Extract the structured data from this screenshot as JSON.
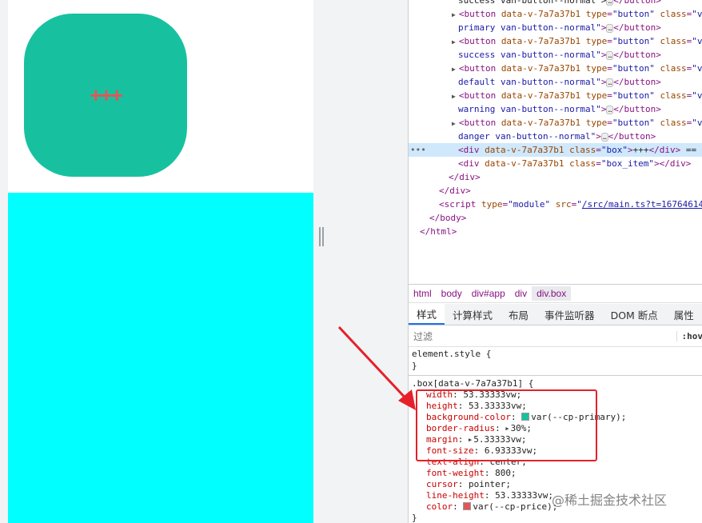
{
  "preview": {
    "box_text": "+++",
    "box_color": "#17c1a0",
    "box_text_color": "#e05757",
    "box_item_color": "#00ffff"
  },
  "dom_lines": [
    {
      "text": "success van-button--normal\"> </button>",
      "parts": [
        [
          "txt",
          "success van-button--normal\">"
        ],
        [
          "ell",
          "…"
        ],
        [
          "tag",
          "</button>"
        ]
      ]
    },
    {
      "parts": [
        [
          "tri",
          "▶"
        ],
        [
          "tag",
          "<button "
        ],
        [
          "attr",
          "data-v-7a7a37b1 type"
        ],
        [
          "tag",
          "="
        ],
        [
          "val",
          "\"button\""
        ],
        [
          "attr",
          " class"
        ],
        [
          "tag",
          "="
        ],
        [
          "val",
          "\"va"
        ]
      ]
    },
    {
      "parts": [
        [
          "val",
          "primary van-button--normal\""
        ],
        [
          "tag",
          ">"
        ],
        [
          "ell",
          "…"
        ],
        [
          "tag",
          "</button>"
        ]
      ]
    },
    {
      "parts": [
        [
          "tri",
          "▶"
        ],
        [
          "tag",
          "<button "
        ],
        [
          "attr",
          "data-v-7a7a37b1 type"
        ],
        [
          "tag",
          "="
        ],
        [
          "val",
          "\"button\""
        ],
        [
          "attr",
          " class"
        ],
        [
          "tag",
          "="
        ],
        [
          "val",
          "\"va"
        ]
      ]
    },
    {
      "parts": [
        [
          "val",
          "success van-button--normal\""
        ],
        [
          "tag",
          ">"
        ],
        [
          "ell",
          "…"
        ],
        [
          "tag",
          "</button>"
        ]
      ]
    },
    {
      "parts": [
        [
          "tri",
          "▶"
        ],
        [
          "tag",
          "<button "
        ],
        [
          "attr",
          "data-v-7a7a37b1 type"
        ],
        [
          "tag",
          "="
        ],
        [
          "val",
          "\"button\""
        ],
        [
          "attr",
          " class"
        ],
        [
          "tag",
          "="
        ],
        [
          "val",
          "\"va"
        ]
      ]
    },
    {
      "parts": [
        [
          "val",
          "default van-button--normal\""
        ],
        [
          "tag",
          ">"
        ],
        [
          "ell",
          "…"
        ],
        [
          "tag",
          "</button>"
        ]
      ]
    },
    {
      "parts": [
        [
          "tri",
          "▶"
        ],
        [
          "tag",
          "<button "
        ],
        [
          "attr",
          "data-v-7a7a37b1 type"
        ],
        [
          "tag",
          "="
        ],
        [
          "val",
          "\"button\""
        ],
        [
          "attr",
          " class"
        ],
        [
          "tag",
          "="
        ],
        [
          "val",
          "\"va"
        ]
      ]
    },
    {
      "parts": [
        [
          "val",
          "warning van-button--normal\""
        ],
        [
          "tag",
          ">"
        ],
        [
          "ell",
          "…"
        ],
        [
          "tag",
          "</button>"
        ]
      ]
    },
    {
      "parts": [
        [
          "tri",
          "▶"
        ],
        [
          "tag",
          "<button "
        ],
        [
          "attr",
          "data-v-7a7a37b1 type"
        ],
        [
          "tag",
          "="
        ],
        [
          "val",
          "\"button\""
        ],
        [
          "attr",
          " class"
        ],
        [
          "tag",
          "="
        ],
        [
          "val",
          "\"va"
        ]
      ]
    },
    {
      "parts": [
        [
          "val",
          "danger van-button--normal\""
        ],
        [
          "tag",
          ">"
        ],
        [
          "ell",
          "…"
        ],
        [
          "tag",
          "</button>"
        ]
      ]
    },
    {
      "parts": [
        [
          "tag",
          "<div "
        ],
        [
          "attr",
          "data-v-7a7a37b1 class"
        ],
        [
          "tag",
          "="
        ],
        [
          "val",
          "\"box\""
        ],
        [
          "tag",
          ">"
        ],
        [
          "txt",
          "+++"
        ],
        [
          "tag",
          "</div>"
        ],
        [
          "txt",
          " == $"
        ]
      ]
    },
    {
      "parts": [
        [
          "tag",
          "<div "
        ],
        [
          "attr",
          "data-v-7a7a37b1 class"
        ],
        [
          "tag",
          "="
        ],
        [
          "val",
          "\"box_item\""
        ],
        [
          "tag",
          "></div>"
        ]
      ]
    },
    {
      "parts": [
        [
          "tag",
          "</div>"
        ]
      ]
    },
    {
      "parts": [
        [
          "tag",
          "</div>"
        ]
      ]
    },
    {
      "parts": [
        [
          "tag",
          "<script "
        ],
        [
          "attr",
          "type"
        ],
        [
          "tag",
          "="
        ],
        [
          "val",
          "\"module\""
        ],
        [
          "attr",
          " src"
        ],
        [
          "tag",
          "="
        ],
        [
          "val",
          "\""
        ],
        [
          "link",
          "/src/main.ts?t=16764614"
        ]
      ]
    },
    {
      "parts": [
        [
          "tag",
          "</body>"
        ]
      ]
    },
    {
      "parts": [
        [
          "tag",
          "</html>"
        ]
      ]
    }
  ],
  "breadcrumbs": [
    "html",
    "body",
    "div#app",
    "div",
    "div.box"
  ],
  "tabs": [
    "样式",
    "计算样式",
    "布局",
    "事件监听器",
    "DOM 断点",
    "属性",
    "无"
  ],
  "filter": {
    "placeholder": "过滤",
    "hov": ":hov"
  },
  "styles": {
    "element_style": "element.style {",
    "close1": "}",
    "selector": ".box[data-v-7a7a37b1] {",
    "props": [
      {
        "name": "width",
        "value": "53.33333vw;"
      },
      {
        "name": "height",
        "value": "53.33333vw;"
      },
      {
        "name": "background-color",
        "value": "var(--cp-primary);",
        "swatch": "#17c1a0"
      },
      {
        "name": "border-radius",
        "value": "30%;",
        "caret": true
      },
      {
        "name": "margin",
        "value": "5.33333vw;",
        "caret": true
      },
      {
        "name": "font-size",
        "value": "6.93333vw;"
      },
      {
        "name": "text-align",
        "value": "center;"
      },
      {
        "name": "font-weight",
        "value": "800;"
      },
      {
        "name": "cursor",
        "value": "pointer;"
      },
      {
        "name": "line-height",
        "value": "53.33333vw;"
      },
      {
        "name": "color",
        "value": "var(--cp-price);",
        "swatch": "#e05757"
      }
    ],
    "close2": "}"
  },
  "watermark": "@稀土掘金技术社区"
}
